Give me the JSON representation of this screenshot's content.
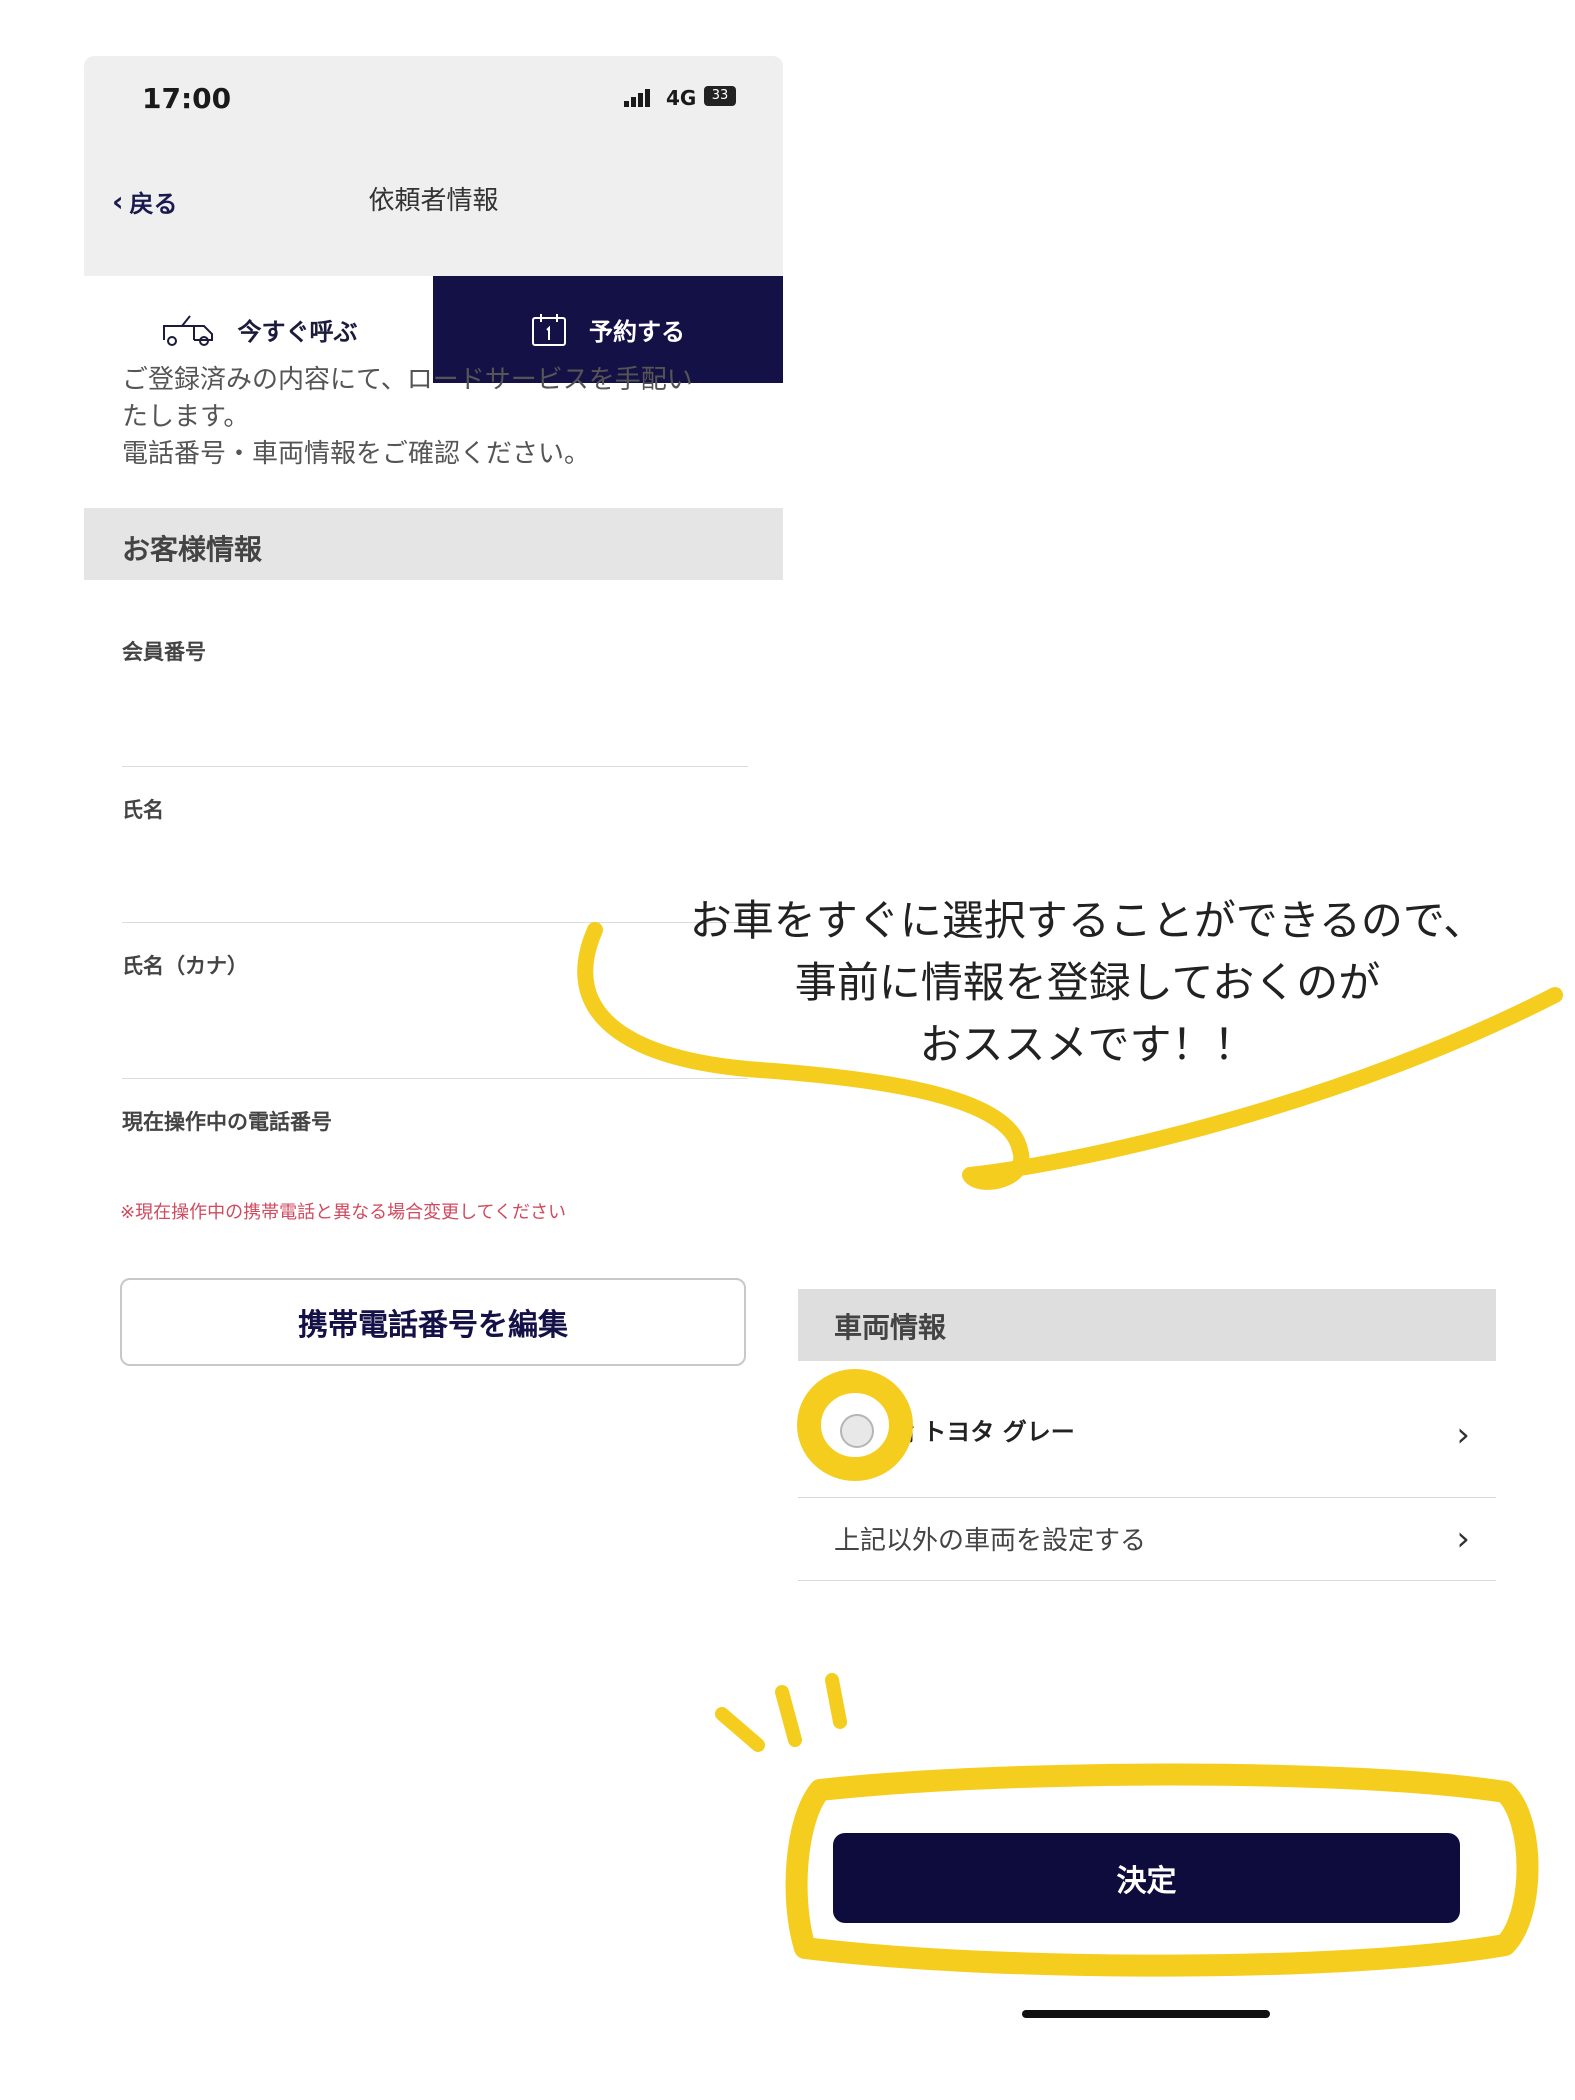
{
  "status_bar": {
    "time": "17:00",
    "network": "4G",
    "battery": "33"
  },
  "nav": {
    "back_label": "戻る",
    "title": "依頼者情報"
  },
  "tabs": [
    {
      "label": "今すぐ呼ぶ",
      "icon": "tow-truck-icon",
      "active": false
    },
    {
      "label": "予約する",
      "icon": "calendar-icon",
      "active": true
    }
  ],
  "intro": {
    "line1": "ご登録済みの内容にて、ロードサービスを手配い",
    "line2": "たします。",
    "line3": "電話番号・車両情報をご確認ください。"
  },
  "customer_section": {
    "title": "お客様情報",
    "fields": [
      {
        "label": "会員番号"
      },
      {
        "label": "氏名"
      },
      {
        "label": "氏名（カナ）"
      },
      {
        "label": "現在操作中の電話番号"
      }
    ],
    "warning": "※現在操作中の携帯電話と異なる場合変更してください",
    "edit_button": "携帯電話番号を編集"
  },
  "annotation": {
    "line1": "お車をすぐに選択することができるので、",
    "line2": "事前に情報を登録しておくのが",
    "line3": "おススメです！！",
    "highlight_color": "#f5cd1e"
  },
  "vehicle_section": {
    "title": "車両情報",
    "vehicle_text": "   輪  トヨタ グレー",
    "other_vehicle": "上記以外の車両を設定する",
    "decide_button": "決定"
  },
  "colors": {
    "primary": "#141147",
    "warning": "#d14a5e",
    "highlight": "#f5cd1e"
  }
}
